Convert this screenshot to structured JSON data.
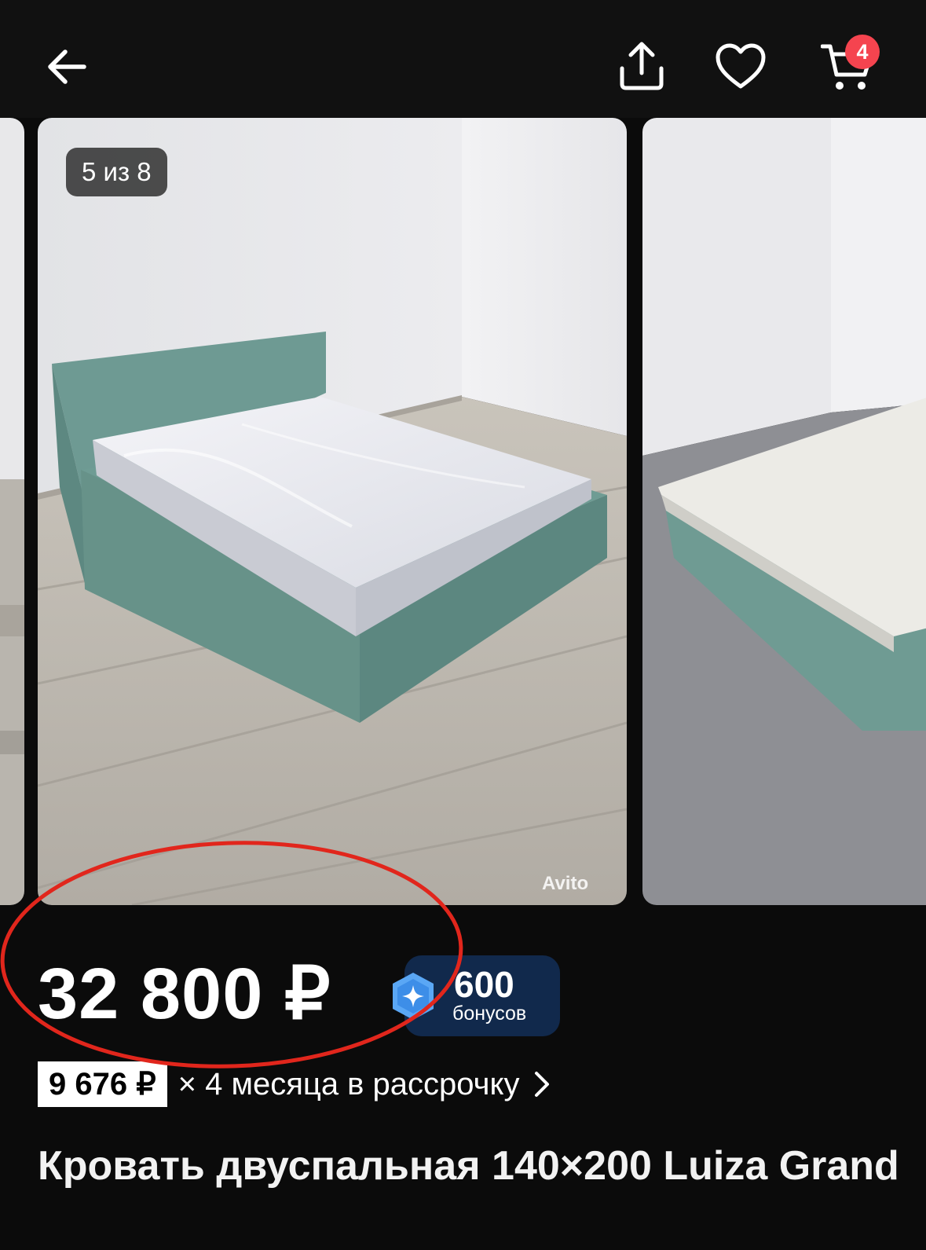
{
  "cart": {
    "badge_count": "4"
  },
  "gallery": {
    "counter_text": "5 из 8",
    "watermark": "Avito"
  },
  "listing": {
    "price": "32 800 ₽",
    "bonus_amount": "600",
    "bonus_label": "бонусов",
    "installment_amount": "9 676 ₽",
    "installment_text": "× 4 месяца в рассрочку",
    "title": "Кровать двуспальная 140×200 Luiza Grand"
  },
  "colors": {
    "background": "#0b0b0b",
    "topbar": "#111111",
    "badge": "#f5444f",
    "bonus_bg": "#11294c",
    "annotation_circle": "#e1261c"
  },
  "icons": [
    "arrow-left-icon",
    "share-icon",
    "heart-icon",
    "cart-icon",
    "bonus-gem-icon",
    "chevron-right-icon"
  ]
}
